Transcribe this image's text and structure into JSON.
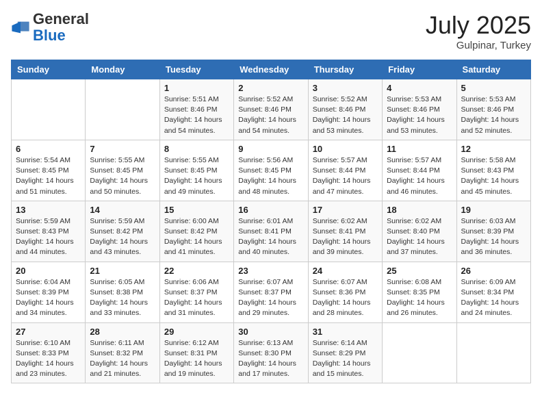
{
  "header": {
    "logo_general": "General",
    "logo_blue": "Blue",
    "month": "July 2025",
    "location": "Gulpinar, Turkey"
  },
  "days_of_week": [
    "Sunday",
    "Monday",
    "Tuesday",
    "Wednesday",
    "Thursday",
    "Friday",
    "Saturday"
  ],
  "weeks": [
    [
      {
        "day": "",
        "sunrise": "",
        "sunset": "",
        "daylight": ""
      },
      {
        "day": "",
        "sunrise": "",
        "sunset": "",
        "daylight": ""
      },
      {
        "day": "1",
        "sunrise": "Sunrise: 5:51 AM",
        "sunset": "Sunset: 8:46 PM",
        "daylight": "Daylight: 14 hours and 54 minutes."
      },
      {
        "day": "2",
        "sunrise": "Sunrise: 5:52 AM",
        "sunset": "Sunset: 8:46 PM",
        "daylight": "Daylight: 14 hours and 54 minutes."
      },
      {
        "day": "3",
        "sunrise": "Sunrise: 5:52 AM",
        "sunset": "Sunset: 8:46 PM",
        "daylight": "Daylight: 14 hours and 53 minutes."
      },
      {
        "day": "4",
        "sunrise": "Sunrise: 5:53 AM",
        "sunset": "Sunset: 8:46 PM",
        "daylight": "Daylight: 14 hours and 53 minutes."
      },
      {
        "day": "5",
        "sunrise": "Sunrise: 5:53 AM",
        "sunset": "Sunset: 8:46 PM",
        "daylight": "Daylight: 14 hours and 52 minutes."
      }
    ],
    [
      {
        "day": "6",
        "sunrise": "Sunrise: 5:54 AM",
        "sunset": "Sunset: 8:45 PM",
        "daylight": "Daylight: 14 hours and 51 minutes."
      },
      {
        "day": "7",
        "sunrise": "Sunrise: 5:55 AM",
        "sunset": "Sunset: 8:45 PM",
        "daylight": "Daylight: 14 hours and 50 minutes."
      },
      {
        "day": "8",
        "sunrise": "Sunrise: 5:55 AM",
        "sunset": "Sunset: 8:45 PM",
        "daylight": "Daylight: 14 hours and 49 minutes."
      },
      {
        "day": "9",
        "sunrise": "Sunrise: 5:56 AM",
        "sunset": "Sunset: 8:45 PM",
        "daylight": "Daylight: 14 hours and 48 minutes."
      },
      {
        "day": "10",
        "sunrise": "Sunrise: 5:57 AM",
        "sunset": "Sunset: 8:44 PM",
        "daylight": "Daylight: 14 hours and 47 minutes."
      },
      {
        "day": "11",
        "sunrise": "Sunrise: 5:57 AM",
        "sunset": "Sunset: 8:44 PM",
        "daylight": "Daylight: 14 hours and 46 minutes."
      },
      {
        "day": "12",
        "sunrise": "Sunrise: 5:58 AM",
        "sunset": "Sunset: 8:43 PM",
        "daylight": "Daylight: 14 hours and 45 minutes."
      }
    ],
    [
      {
        "day": "13",
        "sunrise": "Sunrise: 5:59 AM",
        "sunset": "Sunset: 8:43 PM",
        "daylight": "Daylight: 14 hours and 44 minutes."
      },
      {
        "day": "14",
        "sunrise": "Sunrise: 5:59 AM",
        "sunset": "Sunset: 8:42 PM",
        "daylight": "Daylight: 14 hours and 43 minutes."
      },
      {
        "day": "15",
        "sunrise": "Sunrise: 6:00 AM",
        "sunset": "Sunset: 8:42 PM",
        "daylight": "Daylight: 14 hours and 41 minutes."
      },
      {
        "day": "16",
        "sunrise": "Sunrise: 6:01 AM",
        "sunset": "Sunset: 8:41 PM",
        "daylight": "Daylight: 14 hours and 40 minutes."
      },
      {
        "day": "17",
        "sunrise": "Sunrise: 6:02 AM",
        "sunset": "Sunset: 8:41 PM",
        "daylight": "Daylight: 14 hours and 39 minutes."
      },
      {
        "day": "18",
        "sunrise": "Sunrise: 6:02 AM",
        "sunset": "Sunset: 8:40 PM",
        "daylight": "Daylight: 14 hours and 37 minutes."
      },
      {
        "day": "19",
        "sunrise": "Sunrise: 6:03 AM",
        "sunset": "Sunset: 8:39 PM",
        "daylight": "Daylight: 14 hours and 36 minutes."
      }
    ],
    [
      {
        "day": "20",
        "sunrise": "Sunrise: 6:04 AM",
        "sunset": "Sunset: 8:39 PM",
        "daylight": "Daylight: 14 hours and 34 minutes."
      },
      {
        "day": "21",
        "sunrise": "Sunrise: 6:05 AM",
        "sunset": "Sunset: 8:38 PM",
        "daylight": "Daylight: 14 hours and 33 minutes."
      },
      {
        "day": "22",
        "sunrise": "Sunrise: 6:06 AM",
        "sunset": "Sunset: 8:37 PM",
        "daylight": "Daylight: 14 hours and 31 minutes."
      },
      {
        "day": "23",
        "sunrise": "Sunrise: 6:07 AM",
        "sunset": "Sunset: 8:37 PM",
        "daylight": "Daylight: 14 hours and 29 minutes."
      },
      {
        "day": "24",
        "sunrise": "Sunrise: 6:07 AM",
        "sunset": "Sunset: 8:36 PM",
        "daylight": "Daylight: 14 hours and 28 minutes."
      },
      {
        "day": "25",
        "sunrise": "Sunrise: 6:08 AM",
        "sunset": "Sunset: 8:35 PM",
        "daylight": "Daylight: 14 hours and 26 minutes."
      },
      {
        "day": "26",
        "sunrise": "Sunrise: 6:09 AM",
        "sunset": "Sunset: 8:34 PM",
        "daylight": "Daylight: 14 hours and 24 minutes."
      }
    ],
    [
      {
        "day": "27",
        "sunrise": "Sunrise: 6:10 AM",
        "sunset": "Sunset: 8:33 PM",
        "daylight": "Daylight: 14 hours and 23 minutes."
      },
      {
        "day": "28",
        "sunrise": "Sunrise: 6:11 AM",
        "sunset": "Sunset: 8:32 PM",
        "daylight": "Daylight: 14 hours and 21 minutes."
      },
      {
        "day": "29",
        "sunrise": "Sunrise: 6:12 AM",
        "sunset": "Sunset: 8:31 PM",
        "daylight": "Daylight: 14 hours and 19 minutes."
      },
      {
        "day": "30",
        "sunrise": "Sunrise: 6:13 AM",
        "sunset": "Sunset: 8:30 PM",
        "daylight": "Daylight: 14 hours and 17 minutes."
      },
      {
        "day": "31",
        "sunrise": "Sunrise: 6:14 AM",
        "sunset": "Sunset: 8:29 PM",
        "daylight": "Daylight: 14 hours and 15 minutes."
      },
      {
        "day": "",
        "sunrise": "",
        "sunset": "",
        "daylight": ""
      },
      {
        "day": "",
        "sunrise": "",
        "sunset": "",
        "daylight": ""
      }
    ]
  ]
}
